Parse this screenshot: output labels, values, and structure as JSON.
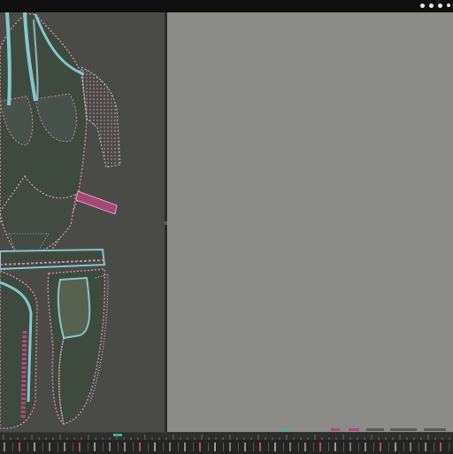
{
  "app": {
    "window_controls": [
      "minimize-control",
      "maximize-control",
      "close-control"
    ]
  },
  "viewport": {
    "name": "3d-garment-view",
    "garment_colors": {
      "fabric": "#3f4a3e",
      "stitch": "#c98aa6",
      "trim_cyan": "#86c6cc",
      "trim_magenta": "#b14a7a"
    }
  },
  "pattern_panel": {
    "name": "2d-pattern-window",
    "background": "#8b8c87"
  },
  "timeline": {
    "tool_count": 30
  }
}
